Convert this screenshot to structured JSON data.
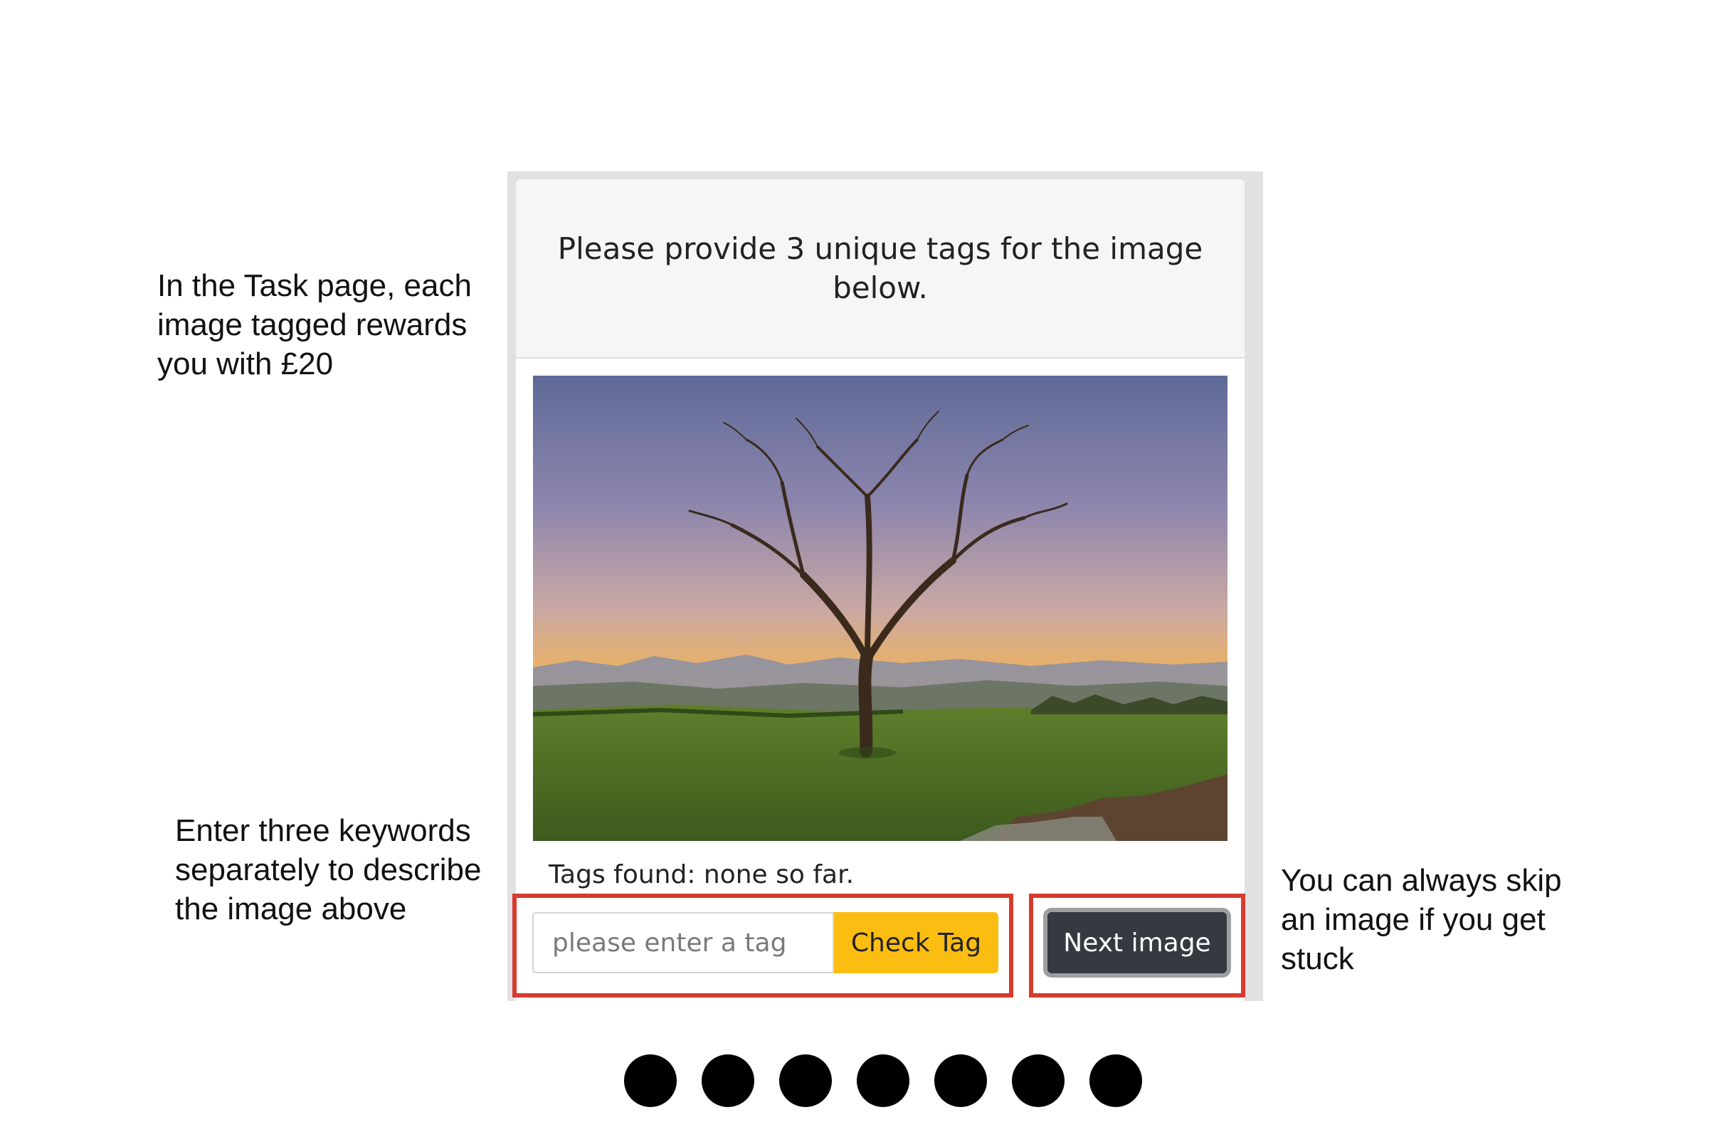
{
  "annotations": {
    "reward_note": "In the Task page, each\nimage tagged rewards\nyou with £20",
    "keywords_note": "Enter three keywords\nseparately to describe\nthe image above",
    "skip_note": "You can always skip\nan image if you get\nstuck"
  },
  "task_card": {
    "instruction": "Please provide 3 unique tags for the image below.",
    "image_subject": "lone bare tree in a green field at sunset",
    "tags_found": "Tags found: none so far.",
    "tag_input": {
      "value": "",
      "placeholder": "please enter a tag"
    },
    "check_tag_label": "Check Tag",
    "next_image_label": "Next image"
  },
  "pagination": {
    "dot_count": 7
  },
  "colors": {
    "highlight": "#d53b2e",
    "check_button": "#fbbd12",
    "next_button": "#343a40",
    "frame": "#e1e1e3"
  }
}
